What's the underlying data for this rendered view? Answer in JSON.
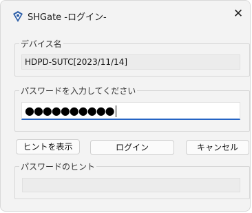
{
  "window": {
    "title": "SHGate -ログイン-",
    "close_symbol": "✕"
  },
  "device": {
    "label": "デバイス名",
    "value": "HDPD-SUTC[2023/11/14]"
  },
  "password": {
    "label": "パスワードを入力してください",
    "masked_value": "●●●●●●●●●●"
  },
  "buttons": {
    "show_hint": "ヒントを表示",
    "login": "ログイン",
    "cancel": "キャンセル"
  },
  "hint": {
    "label": "パスワードのヒント",
    "value": ""
  },
  "colors": {
    "accent": "#2564c5",
    "icon_blue": "#2e5fa8"
  },
  "icons": {
    "app": "shield-key-icon",
    "close": "close-icon"
  }
}
